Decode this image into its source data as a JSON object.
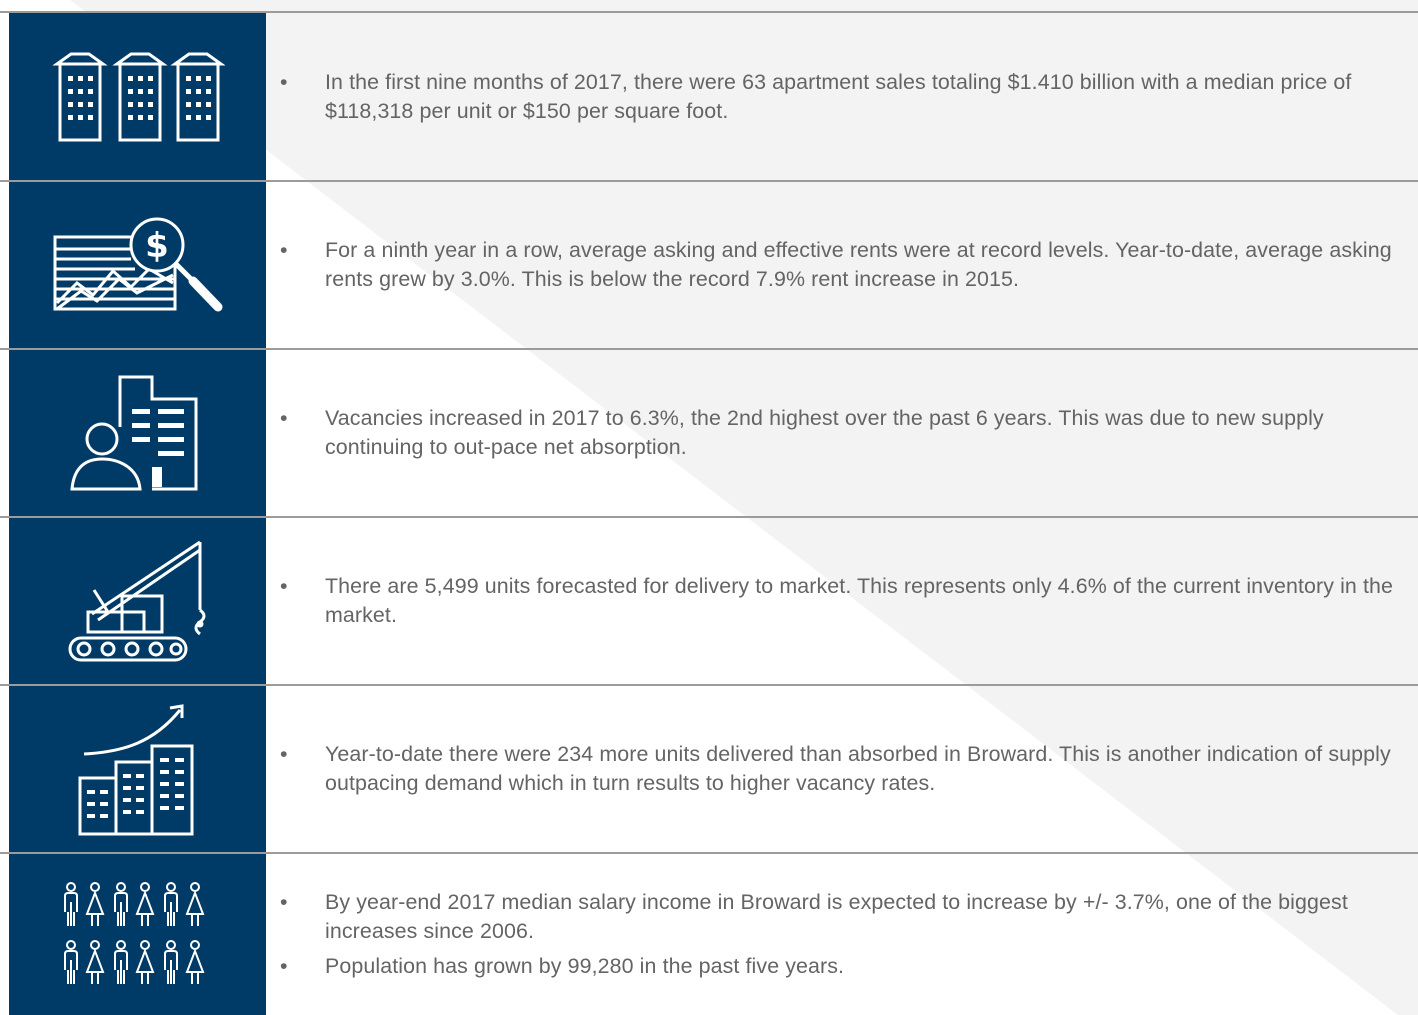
{
  "rows": [
    {
      "icon": "apartment-buildings-icon",
      "bullets": [
        "In the first nine months of 2017, there were 63 apartment sales totaling $1.410 billion with a median price of $118,318 per unit or $150 per square foot."
      ]
    },
    {
      "icon": "rent-analysis-magnifier-icon",
      "bullets": [
        "For a ninth year in a row, average asking and effective rents were at record levels. Year-to-date, average asking rents grew by 3.0%. This is below the record 7.9% rent increase in 2015."
      ]
    },
    {
      "icon": "person-with-building-icon",
      "bullets": [
        "Vacancies increased in 2017 to 6.3%, the 2nd highest over the past 6 years. This was due to new supply continuing to out-pace net absorption."
      ]
    },
    {
      "icon": "construction-crane-icon",
      "bullets": [
        "There are 5,499 units forecasted for delivery to market. This represents only 4.6% of the current inventory in the market."
      ]
    },
    {
      "icon": "growth-buildings-icon",
      "bullets": [
        "Year-to-date there were 234 more units delivered than absorbed in Broward. This is another indication of supply outpacing demand which in turn results to higher vacancy rates."
      ]
    },
    {
      "icon": "population-people-icon",
      "bullets": [
        "By year-end 2017 median salary income in Broward is expected to increase by +/- 3.7%, one of the biggest increases since 2006.",
        "Population has grown by 99,280 in the past five years."
      ]
    }
  ],
  "bullet_char": "•",
  "colors": {
    "icon_panel": "#003a66",
    "text": "#646464",
    "divider": "#9b9b9b",
    "diagonal_shade": "#f3f3f4"
  }
}
